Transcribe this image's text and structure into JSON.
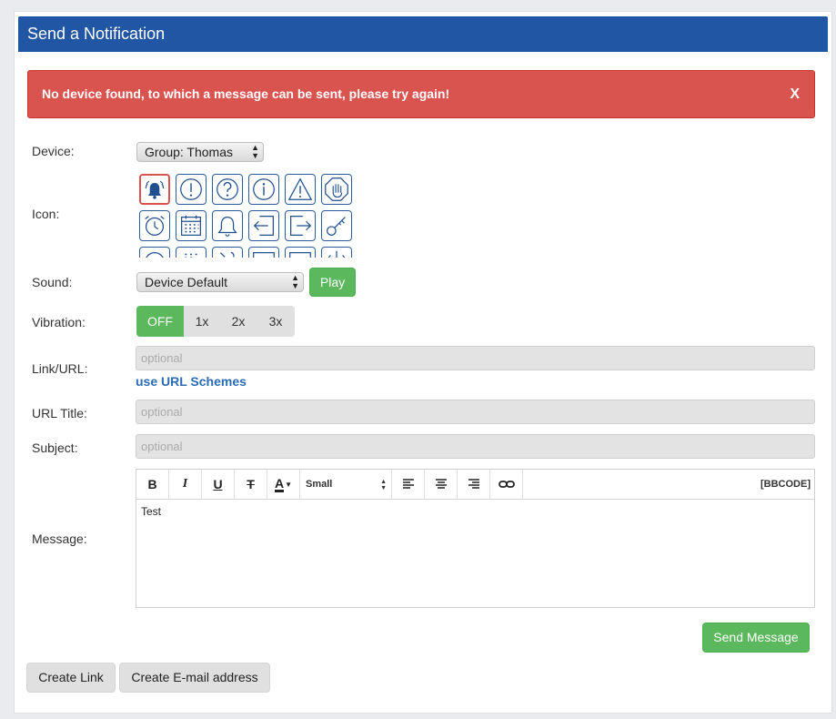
{
  "header": {
    "title": "Send a Notification"
  },
  "alert": {
    "message": "No device found, to which a message can be sent, please try again!",
    "close": "X"
  },
  "form": {
    "device_label": "Device:",
    "device_value": "Group: Thomas",
    "icon_label": "Icon:",
    "sound_label": "Sound:",
    "sound_value": "Device Default",
    "play_label": "Play",
    "vibration_label": "Vibration:",
    "vibration_options": [
      "OFF",
      "1x",
      "2x",
      "3x"
    ],
    "vibration_selected": "OFF",
    "link_label": "Link/URL:",
    "link_placeholder": "optional",
    "url_schemes_link": "use URL Schemes",
    "url_title_label": "URL Title:",
    "url_title_placeholder": "optional",
    "subject_label": "Subject:",
    "subject_placeholder": "optional",
    "message_label": "Message:",
    "message_text": "Test",
    "send_button": "Send Message"
  },
  "editor_toolbar": {
    "bold": "B",
    "italic": "I",
    "underline": "U",
    "strike": "T",
    "color": "A",
    "font_size": "Small",
    "bbcode": "[BBCODE]"
  },
  "icons": [
    "bell-ringing-icon",
    "exclamation-circle-icon",
    "question-circle-icon",
    "info-circle-icon",
    "warning-triangle-icon",
    "stop-hand-icon",
    "alarm-clock-icon",
    "calendar-icon",
    "bell-icon",
    "sign-in-icon",
    "sign-out-icon",
    "key-icon"
  ],
  "footer": {
    "create_link": "Create Link",
    "create_email": "Create E-mail address"
  },
  "colors": {
    "header": "#2156a5",
    "alert": "#d9534f",
    "success": "#5cb85c",
    "link": "#2a6cb5"
  }
}
